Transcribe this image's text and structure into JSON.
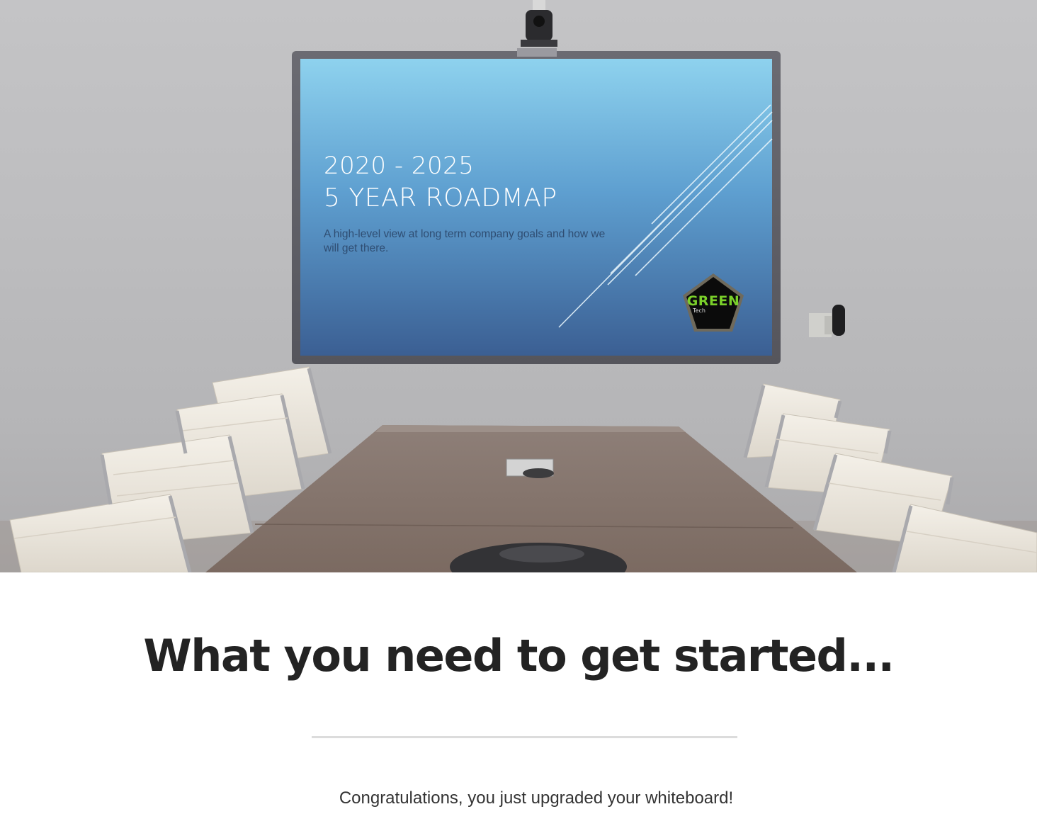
{
  "hero": {
    "slide": {
      "year_range": "2020 - 2025",
      "title": "5 YEAR ROADMAP",
      "subtitle": "A high-level view at long term company goals and how we will get there.",
      "logo_word": "GREEN",
      "logo_sub": "Tech"
    }
  },
  "section": {
    "headline": "What you need to get started...",
    "tagline": "Congratulations, you just upgraded your whiteboard!"
  },
  "colors": {
    "slide_top": "#8ed2ee",
    "slide_bottom": "#3b5f93",
    "logo_green": "#7ad02a",
    "headline": "#232323"
  }
}
